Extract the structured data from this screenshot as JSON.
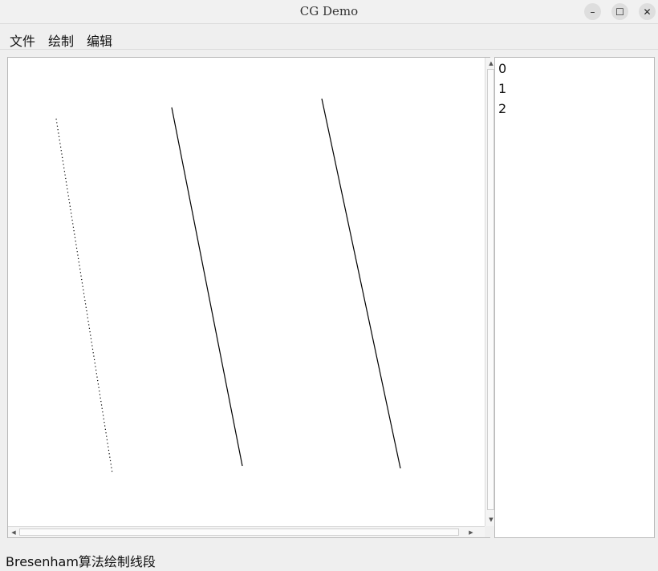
{
  "window": {
    "title": "CG Demo",
    "minimize_glyph": "–",
    "maximize_glyph": "☐",
    "close_glyph": "✕"
  },
  "menu": {
    "items": [
      {
        "label": "文件"
      },
      {
        "label": "绘制"
      },
      {
        "label": "编辑"
      }
    ]
  },
  "canvas": {
    "line_styles": [
      "dotted",
      "solid",
      "solid"
    ]
  },
  "scrollbars": {
    "up_glyph": "▲",
    "down_glyph": "▼",
    "left_glyph": "◀",
    "right_glyph": "▶"
  },
  "item_list": {
    "items": [
      "0",
      "1",
      "2"
    ]
  },
  "status": {
    "text": "Bresenham算法绘制线段"
  },
  "colors": {
    "window_bg": "#efefef",
    "canvas_bg": "#ffffff",
    "line_color": "#000000"
  }
}
